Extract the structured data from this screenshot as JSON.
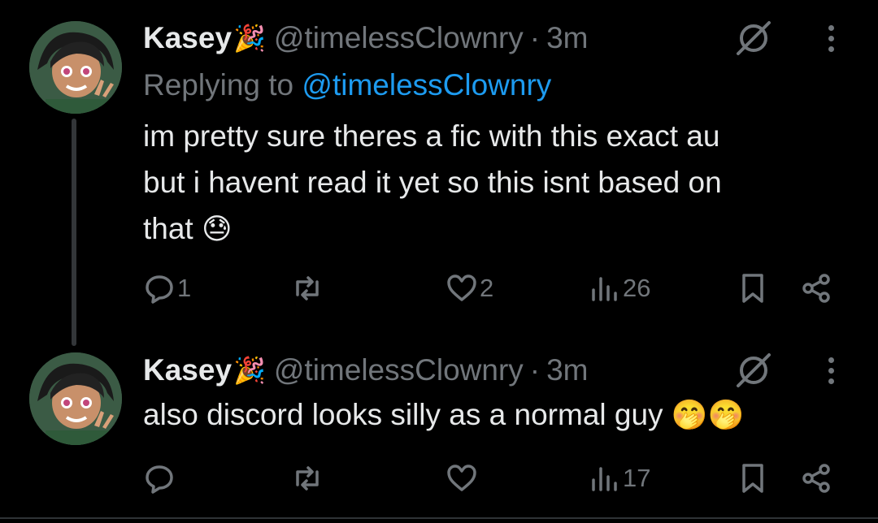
{
  "tweets": [
    {
      "name": "Kasey",
      "name_emoji": "🎉",
      "handle": "@timelessClownry",
      "separator": "·",
      "time": "3m",
      "replying_prefix": "Replying to ",
      "replying_handle": "@timelessClownry",
      "lines": [
        "im pretty sure theres a fic with this exact au",
        "but i havent read it yet so this isnt based on",
        "that"
      ],
      "trailing_emoji": "😓",
      "stats": {
        "replies": "1",
        "retweets": "",
        "likes": "2",
        "views": "26"
      }
    },
    {
      "name": "Kasey",
      "name_emoji": "🎉",
      "handle": "@timelessClownry",
      "separator": "·",
      "time": "3m",
      "lines": [
        "also discord looks silly as a normal guy"
      ],
      "trailing_emoji": "🤭🤭",
      "stats": {
        "replies": "",
        "retweets": "",
        "likes": "",
        "views": "17"
      }
    }
  ],
  "colors": {
    "background": "#000000",
    "text": "#e7e9ea",
    "muted": "#71767b",
    "accent": "#1d9bf0"
  },
  "icons": [
    "avatar",
    "party-popper-emoji",
    "grok-icon",
    "more-icon",
    "reply-icon",
    "retweet-icon",
    "like-icon",
    "views-icon",
    "bookmark-icon",
    "share-icon"
  ]
}
